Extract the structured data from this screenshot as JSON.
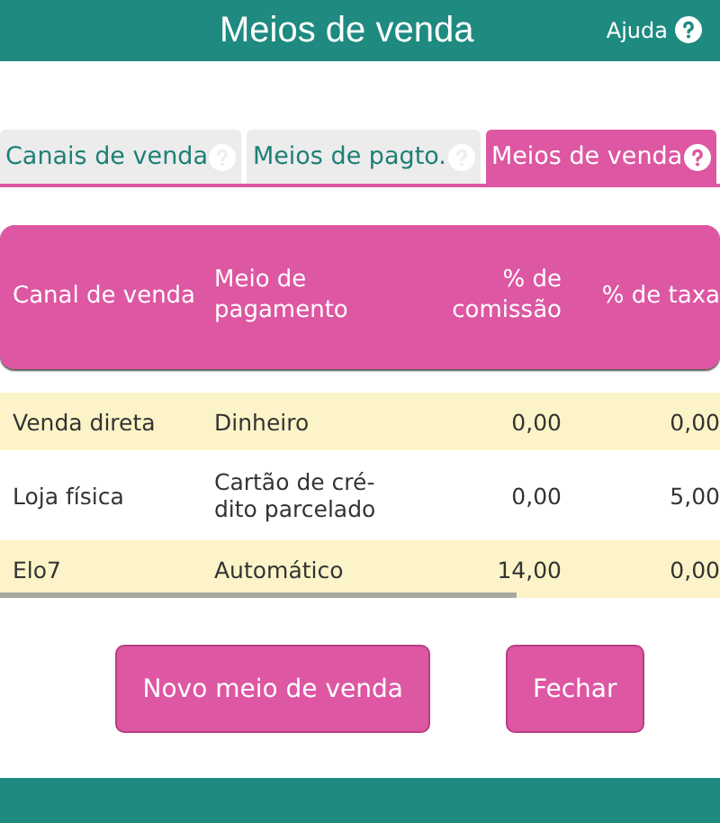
{
  "header": {
    "title": "Meios de venda",
    "help_label": "Ajuda"
  },
  "tabs": [
    {
      "label": "Canais de venda",
      "selected": false
    },
    {
      "label": "Meios de pagto.",
      "selected": false
    },
    {
      "label": "Meios de venda",
      "selected": true
    }
  ],
  "table": {
    "columns": [
      {
        "label": "Canal de venda",
        "kind": "text"
      },
      {
        "label": "Meio de pagamento",
        "kind": "text"
      },
      {
        "label": "% de comissão",
        "kind": "number"
      },
      {
        "label": "% de taxa",
        "kind": "number"
      }
    ],
    "rows": [
      [
        "Venda direta",
        "Dinheiro",
        "0,00",
        "0,00"
      ],
      [
        "Loja física",
        "Cartão de cré-dito parcelado",
        "0,00",
        "5,00"
      ],
      [
        "Elo7",
        "Automático",
        "14,00",
        "0,00"
      ]
    ]
  },
  "buttons": [
    "Novo meio de venda",
    "Fechar"
  ]
}
